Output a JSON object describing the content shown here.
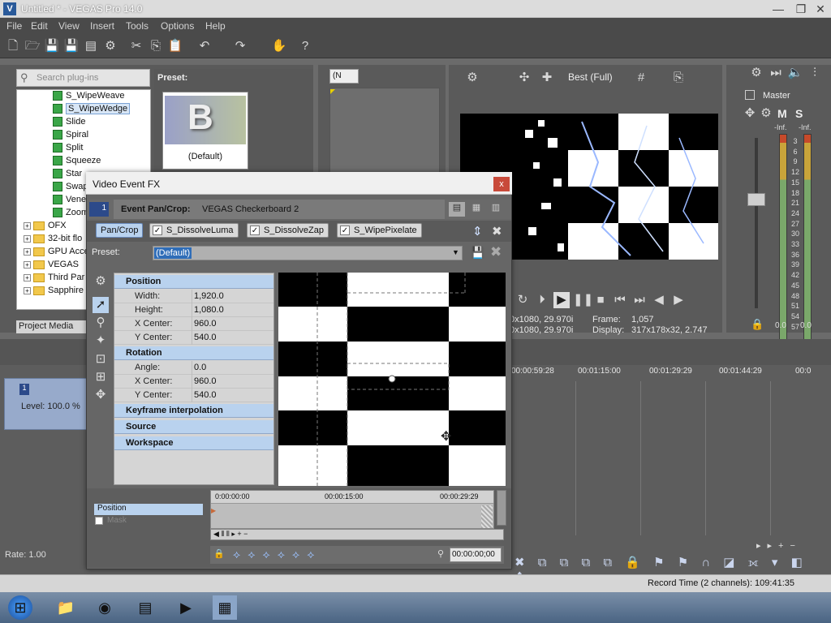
{
  "window": {
    "title": "Untitled * - VEGAS Pro 14.0",
    "min": "—",
    "restore": "❐",
    "close": "✕"
  },
  "menu": [
    "File",
    "Edit",
    "View",
    "Insert",
    "Tools",
    "Options",
    "Help"
  ],
  "plugins": {
    "search_placeholder": "Search plug-ins",
    "items": [
      "S_WipeWeave",
      "S_WipeWedge",
      "Slide",
      "Spiral",
      "Split",
      "Squeeze",
      "Star",
      "Swap",
      "Vene",
      "Zoom"
    ],
    "selected": "S_WipeWedge",
    "folders": [
      "OFX",
      "32-bit flo",
      "GPU Acce",
      "VEGAS",
      "Third Par",
      "Sapphire"
    ],
    "preset_label": "Preset:",
    "preset_name": "(Default)",
    "tab": "Project Media"
  },
  "trimmer": {
    "dropdown": "(N"
  },
  "preview": {
    "quality": "Best (Full)",
    "project_line1": "0x1080, 29.970i",
    "project_line2": "0x1080, 29.970i",
    "frame_label": "Frame:",
    "frame": "1,057",
    "display_label": "Display:",
    "display": "317x178x32, 2.747"
  },
  "master": {
    "title": "Master",
    "m": "M",
    "s": "S",
    "inf_l": "-Inf.",
    "inf_r": "-Inf.",
    "scale": [
      "3",
      "6",
      "9",
      "12",
      "15",
      "18",
      "21",
      "24",
      "27",
      "30",
      "33",
      "36",
      "39",
      "42",
      "45",
      "48",
      "51",
      "54",
      "57"
    ],
    "bottom_l": "0.0",
    "bottom_r": "0.0"
  },
  "timeline": {
    "ruler": [
      "00:00:59:28",
      "00:01:15:00",
      "00:01:29:29",
      "00:01:44:29",
      "00:0"
    ],
    "track_num": "1",
    "track_level": "Level: 100.0 %",
    "rate": "Rate: 1.00",
    "record_time": "Record Time (2 channels): 109:41:35"
  },
  "dialog": {
    "title": "Video Event FX",
    "close": "x",
    "event_num": "1",
    "event_label": "Event Pan/Crop:",
    "event_name": "VEGAS Checkerboard 2",
    "chain": [
      "Pan/Crop",
      "S_DissolveLuma",
      "S_DissolveZap",
      "S_WipePixelate"
    ],
    "preset_label": "Preset:",
    "preset_value": "(Default)",
    "sections": {
      "position": "Position",
      "rotation": "Rotation",
      "keyframe": "Keyframe interpolation",
      "source": "Source",
      "workspace": "Workspace"
    },
    "position_props": [
      {
        "k": "Width:",
        "v": "1,920.0"
      },
      {
        "k": "Height:",
        "v": "1,080.0"
      },
      {
        "k": "X Center:",
        "v": "960.0"
      },
      {
        "k": "Y Center:",
        "v": "540.0"
      }
    ],
    "rotation_props": [
      {
        "k": "Angle:",
        "v": "0.0"
      },
      {
        "k": "X Center:",
        "v": "960.0"
      },
      {
        "k": "Y Center:",
        "v": "540.0"
      }
    ],
    "kf_rows": [
      "Position",
      "Mask"
    ],
    "kf_times": [
      "0:00:00:00",
      "00:00:15:00",
      "00:00:29:29"
    ],
    "kf_time": "00:00:00;00"
  },
  "colors": {
    "accent": "#b9d2ee",
    "chip_selected": "#b9d2ee"
  }
}
